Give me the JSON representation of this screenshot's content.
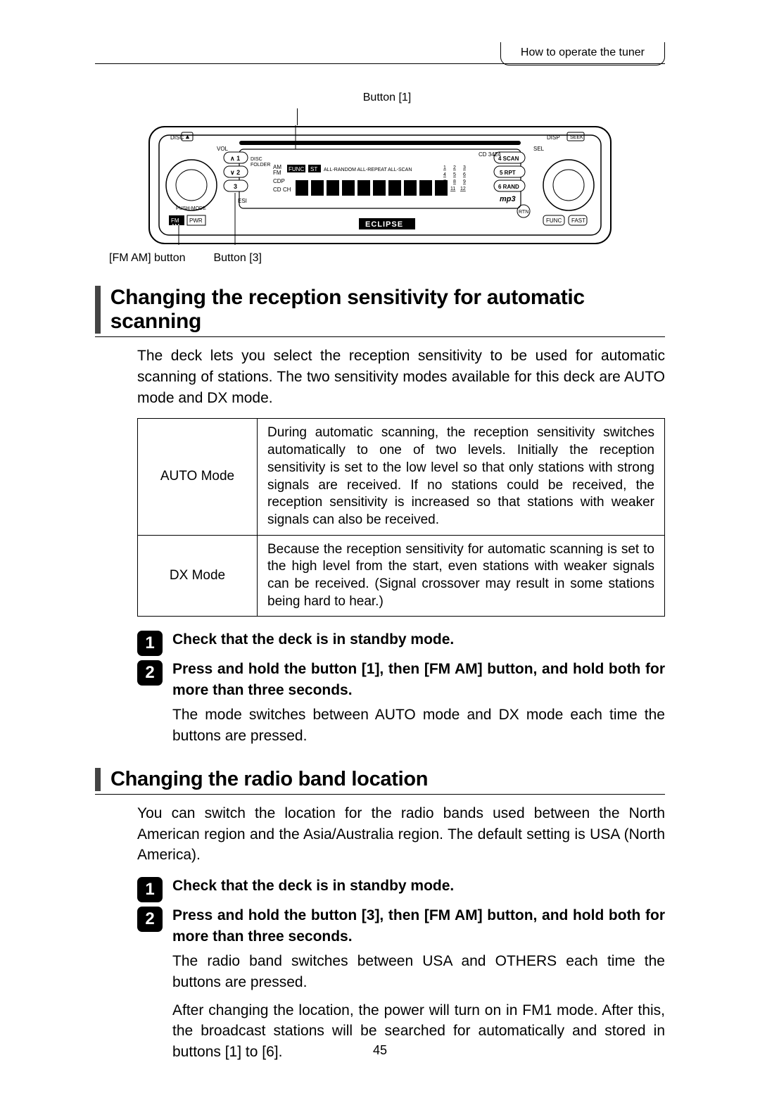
{
  "header": {
    "tab": "How to operate the tuner"
  },
  "diagram": {
    "label_top": "Button [1]",
    "label_fm_am": "[FM AM] button",
    "label_b3": "Button [3]",
    "model": "CD 3424",
    "brand": "ECLIPSE"
  },
  "section1": {
    "title": "Changing the reception sensitivity for automatic scanning",
    "intro": "The deck lets you select the reception sensitivity to be used for automatic scanning of stations. The two sensitivity modes available for this deck are AUTO mode and DX mode.",
    "table": {
      "rows": [
        {
          "mode": "AUTO Mode",
          "desc": "During automatic scanning, the reception sensitivity switches automatically to one of two levels. Initially the reception sensitivity is set to the low level so that only stations with strong signals are received. If no stations could be received, the reception sensitivity is increased so that stations with weaker signals can also be received."
        },
        {
          "mode": "DX Mode",
          "desc": "Because the reception sensitivity for automatic scanning is set to the high level from the start, even stations with weaker signals can be received. (Signal crossover may result in some stations being hard to hear.)"
        }
      ]
    },
    "steps": [
      {
        "n": "1",
        "bold": "Check that the deck is in standby mode."
      },
      {
        "n": "2",
        "bold": "Press and hold the button [1], then [FM AM] button, and hold both for more than three seconds.",
        "sub": "The mode switches between AUTO mode and DX mode each time the buttons are pressed."
      }
    ]
  },
  "section2": {
    "title": "Changing the radio band location",
    "intro": "You can switch the location for the radio bands used between the North American region and the Asia/Australia region. The default setting is USA (North America).",
    "steps": [
      {
        "n": "1",
        "bold": "Check that the deck is in standby mode."
      },
      {
        "n": "2",
        "bold": "Press and hold the button [3], then [FM AM] button, and hold both for more than three seconds.",
        "sub1": "The radio band switches between USA and OTHERS each time the buttons are pressed.",
        "sub2": "After changing the location, the power will turn on in FM1 mode. After this, the broadcast stations will be searched for automatically and stored in buttons [1] to [6]."
      }
    ]
  },
  "page_number": "45"
}
